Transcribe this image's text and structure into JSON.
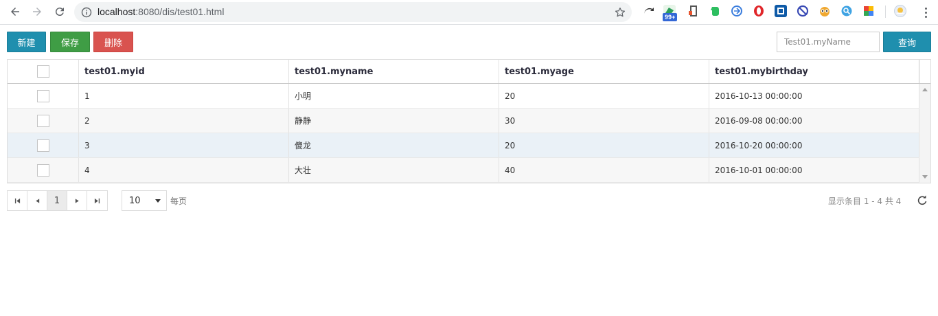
{
  "browser": {
    "url_host": "localhost",
    "url_rest": ":8080/dis/test01.html",
    "extension_badge": "99+"
  },
  "toolbar": {
    "new_label": "新建",
    "save_label": "保存",
    "delete_label": "删除",
    "search_placeholder": "Test01.myName",
    "query_label": "查询"
  },
  "grid": {
    "columns": [
      "test01.myid",
      "test01.myname",
      "test01.myage",
      "test01.mybirthday"
    ],
    "rows": [
      {
        "myid": "1",
        "myname": "小明",
        "myage": "20",
        "mybirthday": "2016-10-13 00:00:00"
      },
      {
        "myid": "2",
        "myname": "静静",
        "myage": "30",
        "mybirthday": "2016-09-08 00:00:00"
      },
      {
        "myid": "3",
        "myname": "傻龙",
        "myage": "20",
        "mybirthday": "2016-10-20 00:00:00"
      },
      {
        "myid": "4",
        "myname": "大壮",
        "myage": "40",
        "mybirthday": "2016-10-01 00:00:00"
      }
    ]
  },
  "pager": {
    "current_page": "1",
    "page_size": "10",
    "per_page_label": "每页",
    "info": "显示条目 1 - 4 共 4"
  },
  "colors": {
    "primary": "#1f8fae",
    "success": "#3f9d45",
    "danger": "#d9534f",
    "row_hover": "#eaf1f7"
  }
}
